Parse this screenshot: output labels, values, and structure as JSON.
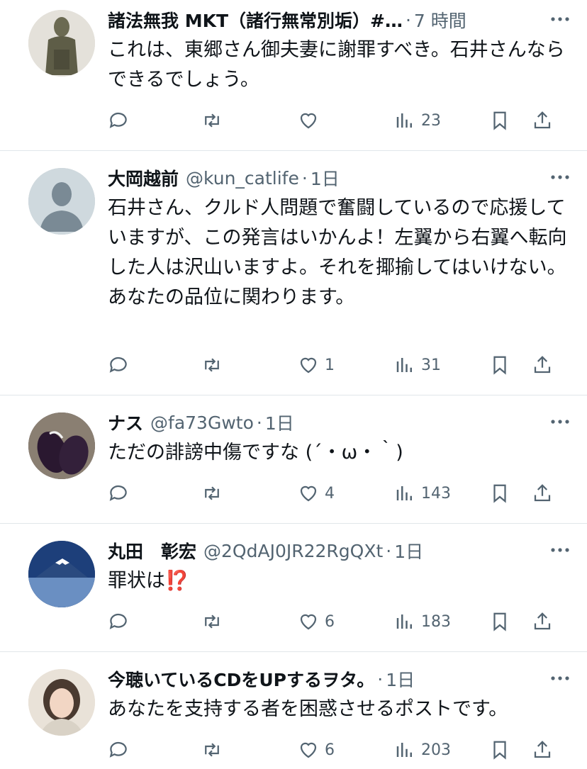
{
  "posts": [
    {
      "name": "諸法無我 MKT（諸行無常別垢）#…",
      "handle": "",
      "time": "7 時間",
      "text": "これは、東郷さん御夫妻に謝罪すべき。石井さんならできるでしょう。",
      "reply_count": "",
      "repost_count": "",
      "like_count": "",
      "view_count": "23"
    },
    {
      "name": "大岡越前",
      "handle": "@kun_catlife",
      "time": "1日",
      "text": "石井さん、クルド人問題で奮闘しているので応援していますが、この発言はいかんよ！左翼から右翼へ転向した人は沢山いますよ。それを揶揄してはいけない。あなたの品位に関わります。",
      "reply_count": "",
      "repost_count": "",
      "like_count": "1",
      "view_count": "31"
    },
    {
      "name": "ナス",
      "handle": "@fa73Gwto",
      "time": "1日",
      "text": "ただの誹謗中傷ですな (´・ω・｀)",
      "reply_count": "",
      "repost_count": "",
      "like_count": "4",
      "view_count": "143"
    },
    {
      "name": "丸田　彰宏",
      "handle": "@2QdAJ0JR22RgQXt",
      "time": "1日",
      "text": "罪状は",
      "emoji": "⁉️",
      "reply_count": "",
      "repost_count": "",
      "like_count": "6",
      "view_count": "183"
    },
    {
      "name": "今聴いているCDをUPするヲタ。",
      "handle": "",
      "time": "1日",
      "text": "あなたを支持する者を困惑させるポストです。",
      "reply_count": "",
      "repost_count": "",
      "like_count": "6",
      "view_count": "203"
    }
  ],
  "colors": {
    "text": "#0f1419",
    "secondary": "#536471",
    "divider": "#e1e6ea"
  },
  "icons": [
    "reply-icon",
    "repost-icon",
    "like-icon",
    "views-icon",
    "bookmark-icon",
    "share-icon",
    "more-icon"
  ]
}
